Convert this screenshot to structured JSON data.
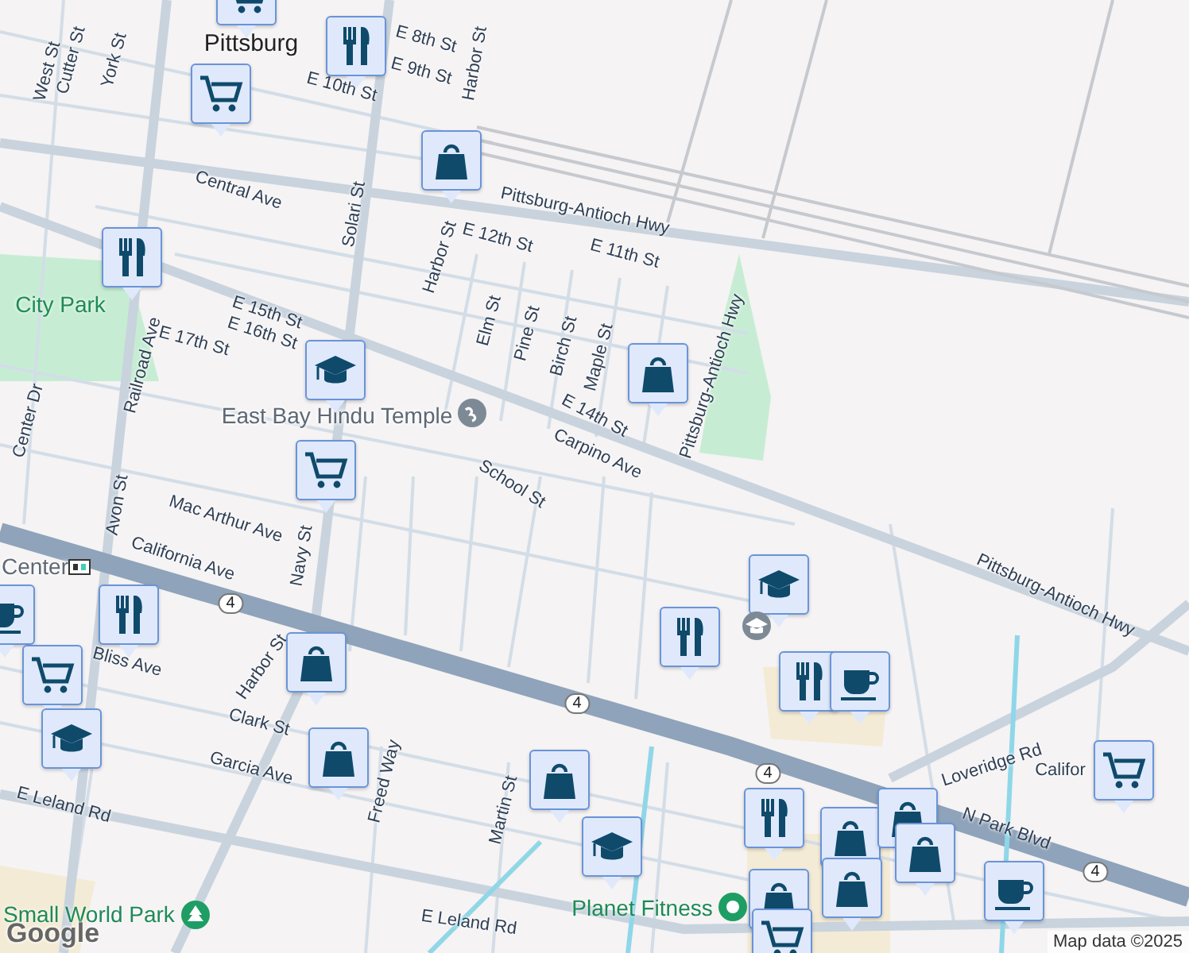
{
  "map": {
    "labels": [
      {
        "text": "West St",
        "kind": "street"
      },
      {
        "text": "Cutter St",
        "kind": "street"
      },
      {
        "text": "York St",
        "kind": "street"
      },
      {
        "text": "Pittsburg",
        "kind": "city"
      },
      {
        "text": "E 8th St",
        "kind": "street"
      },
      {
        "text": "E 9th St",
        "kind": "street"
      },
      {
        "text": "E 10th St",
        "kind": "street"
      },
      {
        "text": "Harbor St",
        "kind": "street"
      },
      {
        "text": "Pittsburg-Antioch Hwy",
        "kind": "street"
      },
      {
        "text": "Central Ave",
        "kind": "street"
      },
      {
        "text": "Solari St",
        "kind": "street"
      },
      {
        "text": "Harbor St",
        "kind": "street"
      },
      {
        "text": "E 12th St",
        "kind": "street"
      },
      {
        "text": "E 11th St",
        "kind": "street"
      },
      {
        "text": "City Park",
        "kind": "park"
      },
      {
        "text": "Railroad Ave",
        "kind": "street"
      },
      {
        "text": "E 15th St",
        "kind": "street"
      },
      {
        "text": "E 16th St",
        "kind": "street"
      },
      {
        "text": "E 17th St",
        "kind": "street"
      },
      {
        "text": "Elm St",
        "kind": "street"
      },
      {
        "text": "Pine St",
        "kind": "street"
      },
      {
        "text": "Birch St",
        "kind": "street"
      },
      {
        "text": "Maple St",
        "kind": "street"
      },
      {
        "text": "E 14th St",
        "kind": "street"
      },
      {
        "text": "Pittsburg-Antioch Hwy",
        "kind": "street"
      },
      {
        "text": "East Bay Hindu Temple",
        "kind": "place"
      },
      {
        "text": "Carpino Ave",
        "kind": "street"
      },
      {
        "text": "Center Dr",
        "kind": "street"
      },
      {
        "text": "School St",
        "kind": "street"
      },
      {
        "text": "Mac Arthur Ave",
        "kind": "street"
      },
      {
        "text": "Avon St",
        "kind": "street"
      },
      {
        "text": "Navy St",
        "kind": "street"
      },
      {
        "text": "Center",
        "kind": "place"
      },
      {
        "text": "California Ave",
        "kind": "street"
      },
      {
        "text": "4",
        "kind": "shield"
      },
      {
        "text": "Bliss Ave",
        "kind": "street"
      },
      {
        "text": "Harbor St",
        "kind": "street"
      },
      {
        "text": "Clark St",
        "kind": "street"
      },
      {
        "text": "Garcia Ave",
        "kind": "street"
      },
      {
        "text": "Freed Way",
        "kind": "street"
      },
      {
        "text": "Martin St",
        "kind": "street"
      },
      {
        "text": "E Leland Rd",
        "kind": "street"
      },
      {
        "text": "4",
        "kind": "shield"
      },
      {
        "text": "Pittsburg-Antioch Hwy",
        "kind": "street"
      },
      {
        "text": "4",
        "kind": "shield"
      },
      {
        "text": "Loveridge Rd",
        "kind": "street"
      },
      {
        "text": "Califor",
        "kind": "street"
      },
      {
        "text": "N Park Blvd",
        "kind": "street"
      },
      {
        "text": "4",
        "kind": "shield"
      },
      {
        "text": "Small World Park",
        "kind": "park"
      },
      {
        "text": "E Leland Rd",
        "kind": "street"
      },
      {
        "text": "Planet Fitness",
        "kind": "park"
      }
    ],
    "markers": [
      {
        "kind": "grocery"
      },
      {
        "kind": "grocery"
      },
      {
        "kind": "restaurant"
      },
      {
        "kind": "shopping"
      },
      {
        "kind": "restaurant"
      },
      {
        "kind": "shopping"
      },
      {
        "kind": "school"
      },
      {
        "kind": "grocery"
      },
      {
        "kind": "restaurant"
      },
      {
        "kind": "cafe"
      },
      {
        "kind": "shopping"
      },
      {
        "kind": "grocery"
      },
      {
        "kind": "school"
      },
      {
        "kind": "shopping"
      },
      {
        "kind": "shopping"
      },
      {
        "kind": "school"
      },
      {
        "kind": "school"
      },
      {
        "kind": "restaurant"
      },
      {
        "kind": "restaurant"
      },
      {
        "kind": "cafe"
      },
      {
        "kind": "grocery"
      },
      {
        "kind": "restaurant"
      },
      {
        "kind": "shopping"
      },
      {
        "kind": "shopping"
      },
      {
        "kind": "shopping"
      },
      {
        "kind": "shopping"
      },
      {
        "kind": "shopping"
      },
      {
        "kind": "grocery"
      },
      {
        "kind": "cafe"
      }
    ]
  },
  "attribution": "Map data ©2025",
  "logo": "Google"
}
